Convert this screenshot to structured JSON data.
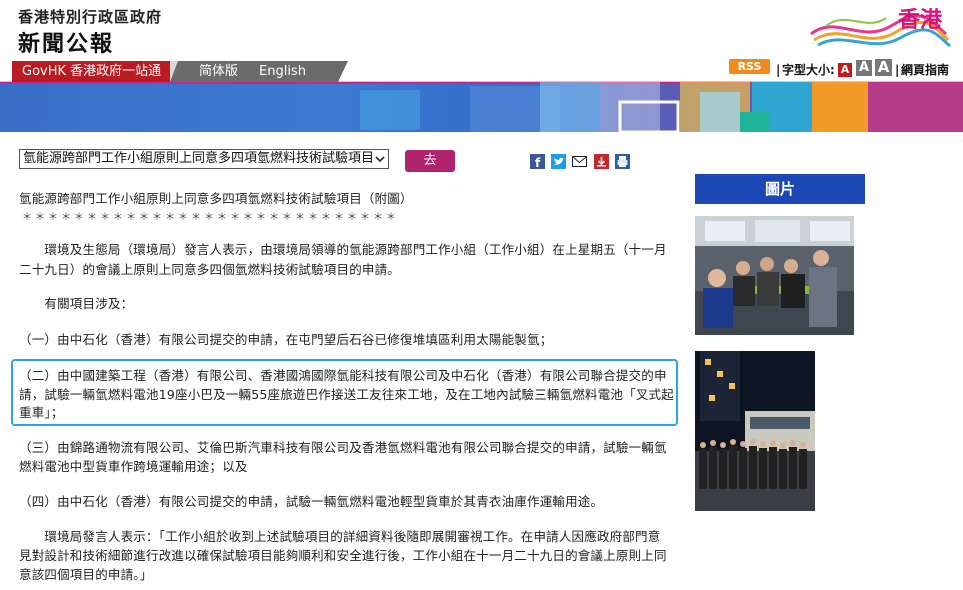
{
  "header": {
    "gov_name": "香港特別行政區政府",
    "site_name": "新聞公報",
    "brand_text": "香港"
  },
  "nav": {
    "govhk_link": "GovHK 香港政府一站通",
    "simplified": "简体版",
    "english": "English"
  },
  "tools": {
    "rss": "RSS",
    "font_size_label": "字型大小:",
    "font_sizes": [
      "A",
      "A",
      "A"
    ],
    "sitemap": "網頁指南",
    "separator": "|"
  },
  "search": {
    "selected_item": "氫能源跨部門工作小組原則上同意多四項氫燃料技術試驗項目",
    "go_label": "去"
  },
  "share_icons": [
    "facebook-icon",
    "twitter-icon",
    "email-icon",
    "save-icon",
    "print-icon"
  ],
  "article": {
    "title": "氫能源跨部門工作小組原則上同意多四項氫燃料技術試驗項目（附圖）",
    "stars": "＊＊＊＊＊＊＊＊＊＊＊＊＊＊＊＊＊＊＊＊＊＊＊＊＊＊＊＊＊",
    "p1_line1": "　　環境及生態局（環境局）發言人表示，由環境局領導的氫能源跨部門工作小組（工作小組）在上星期五（十一月",
    "p1_line2": "二十九日）的會議上原則上同意多四個氫燃料技術試驗項目的申請。",
    "p2": "　　有關項目涉及：",
    "item1": "（一）由中石化（香港）有限公司提交的申請，在屯門望后石谷已修復堆填區利用太陽能製氫；",
    "item2_line1": "（二）由中國建築工程（香港）有限公司、香港國鴻國際氫能科技有限公司及中石化（香港）有限公司聯合提交的申",
    "item2_line2": "請，試驗一輛氫燃料電池19座小巴及一輛55座旅遊巴作接送工友往來工地，及在工地內試驗三輛氫燃料電池「叉式起",
    "item2_line3": "重車」；",
    "item3_line1": "（三）由錦路通物流有限公司、艾倫巴斯汽車科技有限公司及香港氫燃料電池有限公司聯合提交的申請，試驗一輛氫",
    "item3_line2": "燃料電池中型貨車作跨境運輸用途；以及",
    "item4": "（四）由中石化（香港）有限公司提交的申請，試驗一輛氫燃料電池輕型貨車於其青衣油庫作運輸用途。",
    "p3_line1": "　　環境局發言人表示：「工作小組於收到上述試驗項目的詳細資料後隨即展開審視工作。在申請人因應政府部門意",
    "p3_line2": "見對設計和技術細節進行改進以確保試驗項目能夠順利和安全進行後，工作小組在十一月二十九日的會議上原則上同",
    "p3_line3": "意該四個項目的申請。」"
  },
  "sidebar": {
    "heading": "圖片"
  },
  "colors": {
    "accent_magenta": "#b0246e",
    "govhk_red": "#b81c22",
    "picture_heading_blue": "#1c48b5",
    "highlight_blue": "#2fa3e6"
  }
}
